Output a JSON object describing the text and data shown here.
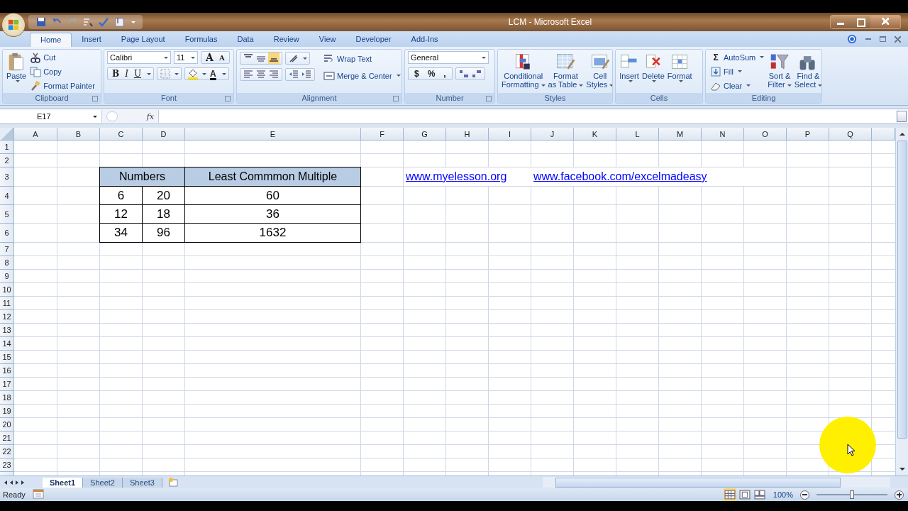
{
  "window": {
    "title": "LCM - Microsoft Excel"
  },
  "tabs": [
    {
      "label": "Home",
      "selected": true
    },
    {
      "label": "Insert",
      "selected": false
    },
    {
      "label": "Page Layout",
      "selected": false
    },
    {
      "label": "Formulas",
      "selected": false
    },
    {
      "label": "Data",
      "selected": false
    },
    {
      "label": "Review",
      "selected": false
    },
    {
      "label": "View",
      "selected": false
    },
    {
      "label": "Developer",
      "selected": false
    },
    {
      "label": "Add-Ins",
      "selected": false
    }
  ],
  "ribbon": {
    "clipboard": {
      "label": "Clipboard",
      "paste": "Paste",
      "items": [
        "Cut",
        "Copy",
        "Format Painter"
      ]
    },
    "font": {
      "label": "Font",
      "family": "Calibri",
      "size": "11",
      "size_buttons": [
        "A",
        "A"
      ],
      "style_buttons": [
        "B",
        "I",
        "U"
      ],
      "color_button": "A"
    },
    "alignment": {
      "label": "Alignment",
      "wrap": "Wrap Text",
      "merge": "Merge & Center"
    },
    "number": {
      "label": "Number",
      "format": "General",
      "buttons": [
        "$",
        "%",
        ","
      ]
    },
    "styles": {
      "label": "Styles",
      "items": [
        [
          "Conditional",
          "Formatting"
        ],
        [
          "Format",
          "as Table"
        ],
        [
          "Cell",
          "Styles"
        ]
      ]
    },
    "cells": {
      "label": "Cells",
      "items": [
        "Insert",
        "Delete",
        "Format"
      ]
    },
    "editing": {
      "label": "Editing",
      "sigma": "Σ",
      "small": [
        "AutoSum",
        "Fill",
        "Clear"
      ],
      "big": [
        [
          "Sort &",
          "Filter"
        ],
        [
          "Find &",
          "Select"
        ]
      ]
    }
  },
  "formula_bar": {
    "name_box": "E17",
    "fx": "fx"
  },
  "columns": [
    "A",
    "B",
    "C",
    "D",
    "E",
    "F",
    "G",
    "H",
    "I",
    "J",
    "K",
    "L",
    "M",
    "N",
    "O",
    "P",
    "Q"
  ],
  "rows": [
    "1",
    "2",
    "3",
    "4",
    "5",
    "6",
    "7",
    "8",
    "9",
    "10",
    "11",
    "12",
    "13",
    "14",
    "15",
    "16",
    "17",
    "18",
    "19",
    "20",
    "21",
    "22",
    "23"
  ],
  "table": {
    "header": [
      "Numbers",
      "Least Commmon Multiple"
    ],
    "rows": [
      [
        "6",
        "20",
        "60"
      ],
      [
        "12",
        "18",
        "36"
      ],
      [
        "34",
        "96",
        "1632"
      ]
    ]
  },
  "links": [
    "www.myelesson.org",
    "www.facebook.com/excelmadeasy"
  ],
  "sheet_tabs": [
    {
      "label": "Sheet1",
      "selected": true
    },
    {
      "label": "Sheet2",
      "selected": false
    },
    {
      "label": "Sheet3",
      "selected": false
    }
  ],
  "status_bar": {
    "text": "Ready",
    "zoom": "100%",
    "zoom_slider": {
      "level": 0.5
    },
    "views": [
      {
        "selected": true
      },
      {
        "selected": false
      },
      {
        "selected": false
      }
    ]
  }
}
